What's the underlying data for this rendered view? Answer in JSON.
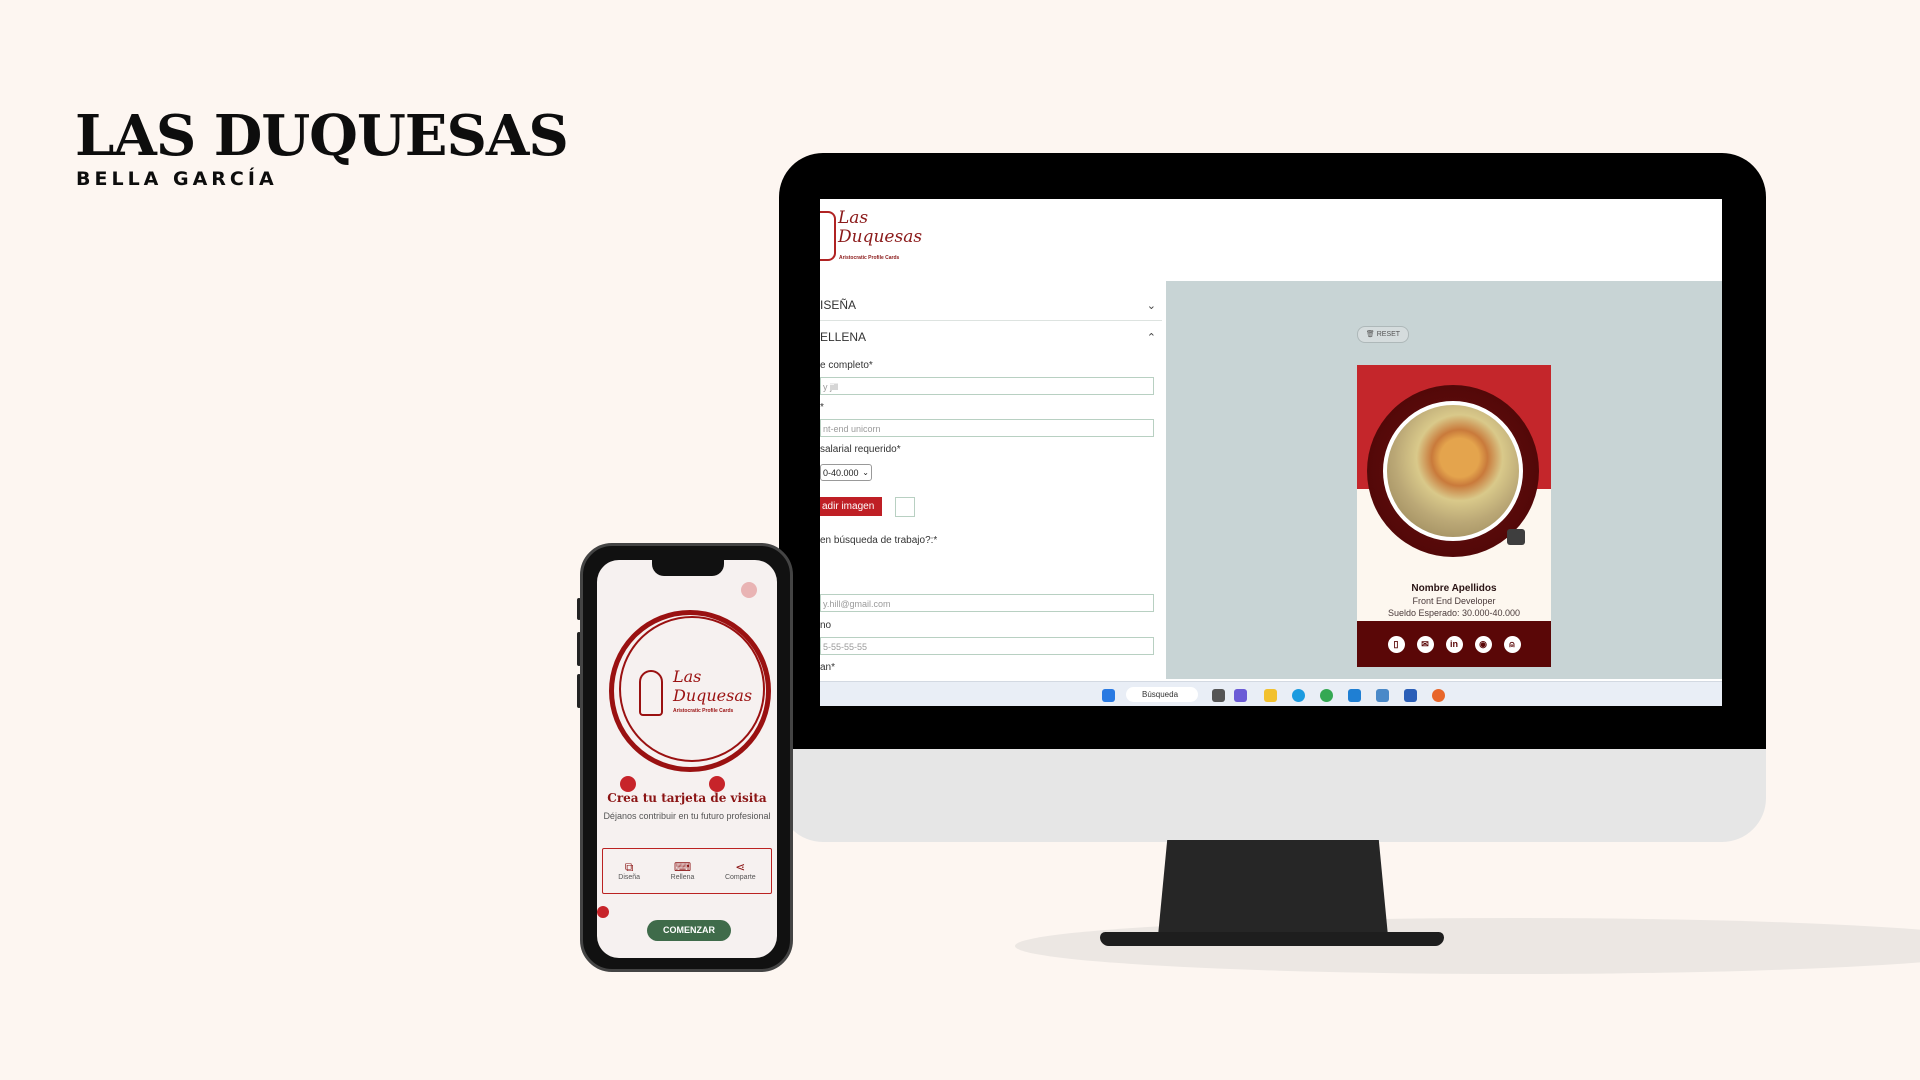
{
  "brand": {
    "title": "LAS DUQUESAS",
    "subtitle": "BELLA GARCÍA"
  },
  "desktop_app": {
    "logo": {
      "text_line1": "Las",
      "text_line2": "Duquesas",
      "tagline": "Aristocratic Profile Cards"
    },
    "accordion": [
      {
        "label": "ISEÑA",
        "chevron": "chevron-down-icon"
      },
      {
        "label": "ELLENA",
        "chevron": "chevron-up-icon"
      }
    ],
    "form": {
      "name_label": "e completo*",
      "name_placeholder": "y jill",
      "role_label": "*",
      "role_placeholder": "nt-end unicorn",
      "salary_label": "salarial requerido*",
      "salary_value": "0-40.000",
      "upload_label": "adir imagen",
      "job_search_label": "en búsqueda de trabajo?:*",
      "email_placeholder": "y.hill@gmail.com",
      "phone_label": "no",
      "phone_placeholder": "5-55-55-55",
      "linkedin_label": "an*"
    },
    "preview": {
      "reset_label": "RESET",
      "card": {
        "name": "Nombre Apellidos",
        "role": "Front End Developer",
        "salary": "Sueldo Esperado: 30.000-40.000",
        "social_icons": [
          "phone-icon",
          "mail-icon",
          "linkedin-icon",
          "github-icon",
          "user-icon"
        ],
        "social_glyphs": [
          "▯",
          "✉",
          "in",
          "◉",
          "⍝"
        ]
      }
    },
    "taskbar": {
      "search_label": "Búsqueda",
      "icons": [
        "windows-icon",
        "files-icon",
        "teams-icon",
        "folder-icon",
        "edge-icon",
        "chrome-icon",
        "vscode-icon",
        "notepad-icon",
        "word-icon",
        "firefox-icon"
      ]
    },
    "colors": {
      "primary_red": "#c4262b",
      "dark_red": "#5a0707",
      "preview_bg": "#c8d4d5"
    }
  },
  "mobile_app": {
    "logo": {
      "text_line1": "Las",
      "text_line2": "Duquesas",
      "tagline": "Aristocratic Profile Cards"
    },
    "headline": "Crea tu tarjeta de visita",
    "subheadline": "Déjanos contribuir en tu futuro profesional",
    "steps": [
      {
        "label": "Diseña",
        "icon": "design-icon",
        "glyph": "⧉"
      },
      {
        "label": "Rellena",
        "icon": "keyboard-icon",
        "glyph": "⌨"
      },
      {
        "label": "Comparte",
        "icon": "share-icon",
        "glyph": "⋖"
      }
    ],
    "cta_label": "COMENZAR",
    "colors": {
      "cta_green": "#3f6b4a",
      "accent_red": "#9a1111"
    }
  }
}
